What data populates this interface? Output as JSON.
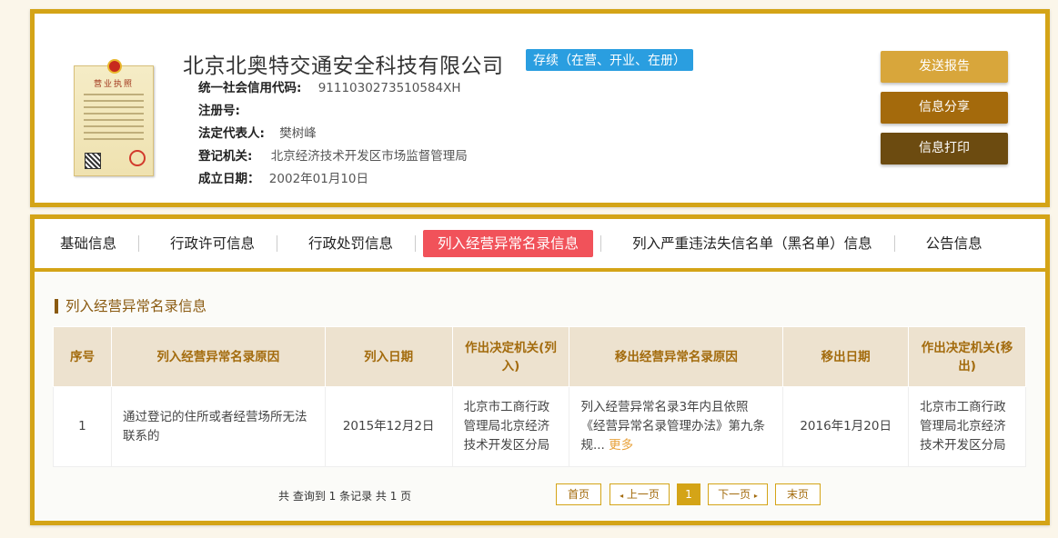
{
  "company": {
    "name": "北京北奥特交通安全科技有限公司",
    "status": "存续（在营、开业、在册）",
    "license_title": "营业执照"
  },
  "details": [
    {
      "label": "统一社会信用代码:",
      "value": "9111030273510584XH"
    },
    {
      "label": "注册号:",
      "value": ""
    },
    {
      "label": "法定代表人:",
      "value": "樊树峰"
    },
    {
      "label": "登记机关:",
      "value": "北京经济技术开发区市场监督管理局"
    },
    {
      "label": "成立日期：",
      "value": "2002年01月10日"
    }
  ],
  "actions": {
    "send": "发送报告",
    "share": "信息分享",
    "print": "信息打印"
  },
  "tabs": [
    "基础信息",
    "行政许可信息",
    "行政处罚信息",
    "列入经营异常名录信息",
    "列入严重违法失信名单（黑名单）信息",
    "公告信息"
  ],
  "active_tab": "列入经营异常名录信息",
  "section_title": "列入经营异常名录信息",
  "table": {
    "headers": [
      "序号",
      "列入经营异常名录原因",
      "列入日期",
      "作出决定机关(列入)",
      "移出经营异常名录原因",
      "移出日期",
      "作出决定机关(移出)"
    ],
    "rows": [
      {
        "no": "1",
        "reason_in": "通过登记的住所或者经营场所无法联系的",
        "date_in": "2015年12月2日",
        "authority_in": "北京市工商行政管理局北京经济技术开发区分局",
        "reason_out": "列入经营异常名录3年内且依照《经营异常名录管理办法》第九条规...",
        "more": "更多",
        "date_out": "2016年1月20日",
        "authority_out": "北京市工商行政管理局北京经济技术开发区分局"
      }
    ]
  },
  "pagination": {
    "summary": "共 查询到 1 条记录 共 1 页",
    "first": "首页",
    "prev": "上一页",
    "current": "1",
    "next": "下一页",
    "last": "末页"
  },
  "colors": {
    "frame": "#d4a417",
    "status_badge": "#2a9ee0",
    "active_tab": "#f1525a",
    "btn_send": "#d8a63b",
    "btn_share": "#a46a0c",
    "btn_print": "#6c4b10"
  }
}
